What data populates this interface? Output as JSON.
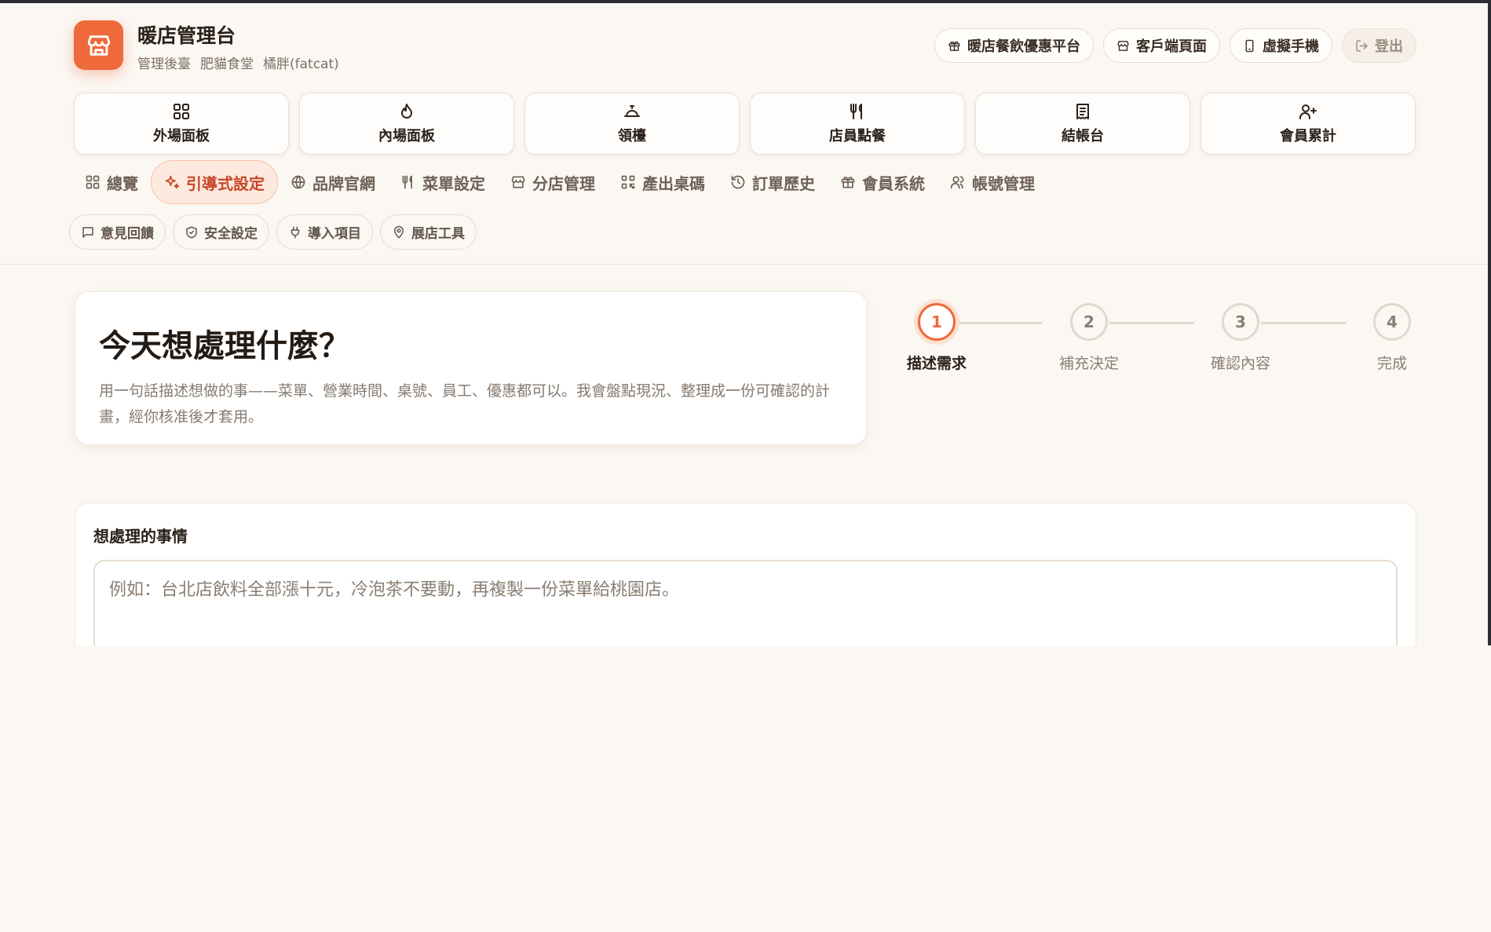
{
  "header": {
    "title": "暖店管理台",
    "subtitle": [
      "管理後臺",
      "肥貓食堂",
      "橘胖(fatcat)"
    ],
    "logo_icon": "storefront-icon",
    "accent_color": "#ef6a3a"
  },
  "top_actions": [
    {
      "label": "暖店餐飲優惠平台",
      "icon": "gift-icon"
    },
    {
      "label": "客戶端頁面",
      "icon": "store-icon"
    },
    {
      "label": "虛擬手機",
      "icon": "phone-icon"
    },
    {
      "label": "登出",
      "icon": "logout-icon"
    }
  ],
  "panels": [
    {
      "label": "外場面板",
      "icon": "grid-icon"
    },
    {
      "label": "內場面板",
      "icon": "flame-icon"
    },
    {
      "label": "領檯",
      "icon": "bell-icon"
    },
    {
      "label": "店員點餐",
      "icon": "utensils-icon"
    },
    {
      "label": "結帳台",
      "icon": "receipt-icon"
    },
    {
      "label": "會員累計",
      "icon": "user-plus-icon"
    }
  ],
  "nav": [
    {
      "label": "總覽",
      "icon": "grid-icon",
      "active": false
    },
    {
      "label": "引導式設定",
      "icon": "sparkle-icon",
      "active": true
    },
    {
      "label": "品牌官網",
      "icon": "globe-icon",
      "active": false
    },
    {
      "label": "菜單設定",
      "icon": "utensils-icon",
      "active": false
    },
    {
      "label": "分店管理",
      "icon": "store-icon",
      "active": false
    },
    {
      "label": "產出桌碼",
      "icon": "qrcode-icon",
      "active": false
    },
    {
      "label": "訂單歷史",
      "icon": "history-icon",
      "active": false
    },
    {
      "label": "會員系統",
      "icon": "gift-icon",
      "active": false
    },
    {
      "label": "帳號管理",
      "icon": "users-icon",
      "active": false
    }
  ],
  "tags": [
    {
      "label": "意見回饋",
      "icon": "message-icon"
    },
    {
      "label": "安全設定",
      "icon": "shield-icon"
    },
    {
      "label": "導入項目",
      "icon": "plug-icon"
    },
    {
      "label": "展店工具",
      "icon": "map-pin-icon"
    }
  ],
  "intro": {
    "heading": "今天想處理什麼？",
    "description": "用一句話描述想做的事——菜單、營業時間、桌號、員工、優惠都可以。我會盤點現況、整理成一份可確認的計畫，經你核准後才套用。"
  },
  "stepper": {
    "current": 1,
    "steps": [
      {
        "number": "1",
        "label": "描述需求"
      },
      {
        "number": "2",
        "label": "補充決定"
      },
      {
        "number": "3",
        "label": "確認內容"
      },
      {
        "number": "4",
        "label": "完成"
      }
    ]
  },
  "form": {
    "label": "想處理的事情",
    "value": "",
    "placeholder": "例如：台北店飲料全部漲十元，冷泡茶不要動，再複製一份菜單給桃園店。"
  }
}
